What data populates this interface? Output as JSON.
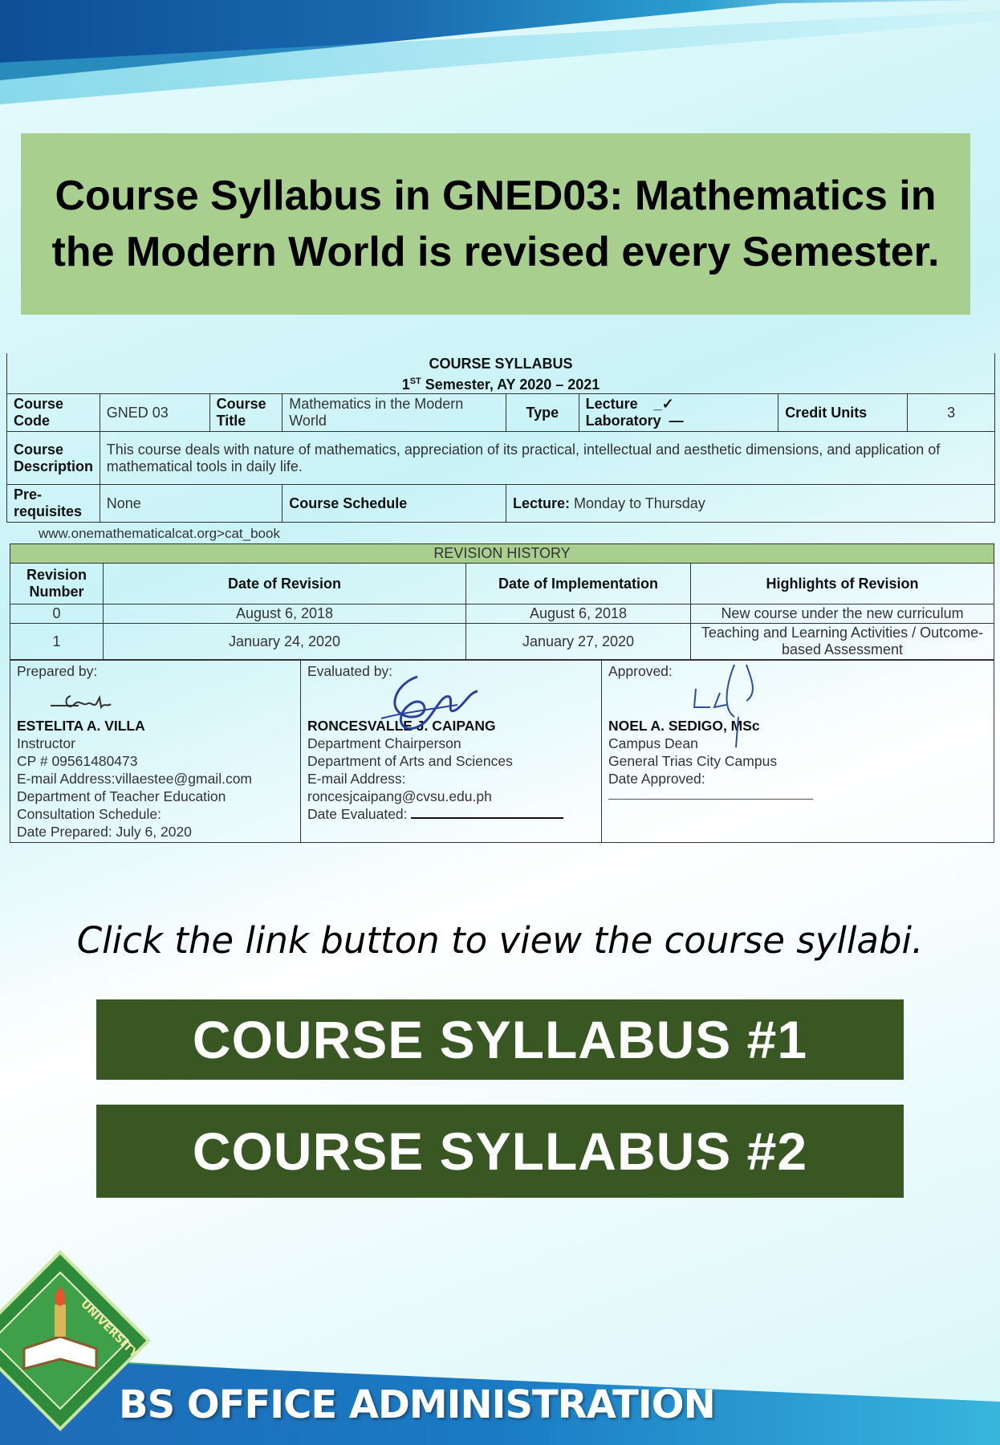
{
  "headline": "Course Syllabus in GNED03: Mathematics in the Modern World is revised every Semester.",
  "syllabus": {
    "title": "COURSE SYLLABUS",
    "semester_prefix": "1",
    "semester_sup": "ST",
    "semester_rest": "Semester, AY 2020 – 2021",
    "course_code_label": "Course Code",
    "course_code": "GNED 03",
    "course_title_label": "Course Title",
    "course_title": "Mathematics in the Modern World",
    "type_label": "Type",
    "lecture_label": "Lecture",
    "lecture_mark": "_✓",
    "laboratory_label": "Laboratory",
    "laboratory_mark": "—",
    "credit_units_label": "Credit Units",
    "credit_units": "3",
    "description_label": "Course Description",
    "description": "This course deals with nature of mathematics, appreciation of its practical, intellectual and aesthetic dimensions, and application of mathematical tools in daily life.",
    "prereq_label": "Pre-requisites",
    "prereq": "None",
    "schedule_label": "Course Schedule",
    "lecture_sched_label": "Lecture:",
    "lecture_sched": "Monday to Thursday",
    "url": "www.onemathematicalcat.org>cat_book"
  },
  "revision": {
    "title": "REVISION HISTORY",
    "headers": [
      "Revision Number",
      "Date of Revision",
      "Date of Implementation",
      "Highlights of Revision"
    ],
    "rows": [
      [
        "0",
        "August 6, 2018",
        "August 6, 2018",
        "New course under the new curriculum"
      ],
      [
        "1",
        "January 24, 2020",
        "January 27, 2020",
        "Teaching and Learning Activities / Outcome-based Assessment"
      ]
    ]
  },
  "signatories": {
    "prepared": {
      "label": "Prepared by:",
      "name": "ESTELITA A. VILLA",
      "lines": [
        "Instructor",
        "CP # 09561480473",
        "E-mail Address:villaestee@gmail.com",
        "Department of Teacher Education",
        "Consultation Schedule:",
        "Date Prepared: July 6, 2020"
      ]
    },
    "evaluated": {
      "label": "Evaluated by:",
      "name": "RONCESVALLE J. CAIPANG",
      "lines": [
        "Department Chairperson",
        "Department of Arts and Sciences",
        "E-mail Address:",
        "roncesjcaipang@cvsu.edu.ph"
      ],
      "date_label": "Date Evaluated:"
    },
    "approved": {
      "label": "Approved:",
      "name": "NOEL A. SEDIGO, MSc",
      "lines": [
        "Campus Dean",
        "General Trias City Campus",
        "Date Approved:"
      ]
    }
  },
  "cta_text": "Click the link button to view the course syllabi.",
  "buttons": [
    "COURSE SYLLABUS #1",
    "COURSE SYLLABUS #2"
  ],
  "footer_title": "BS OFFICE ADMINISTRATION",
  "logo_text": "UNIVERSITY",
  "colors": {
    "headline_bg": "#a9cf8e",
    "button_bg": "#385723",
    "button_text": "#ffffff"
  }
}
